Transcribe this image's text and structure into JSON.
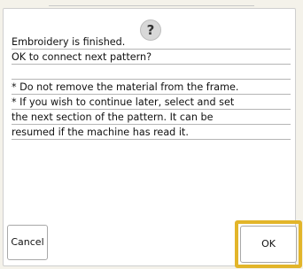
{
  "dialog": {
    "icon": "question-icon",
    "icon_glyph": "?",
    "message_lines": [
      "Embroidery is finished.",
      "OK to connect next pattern?",
      "",
      "* Do not remove the material from the frame.",
      "* If you wish to continue later, select and set",
      "the next section of the pattern. It can be",
      "resumed if the machine has read it."
    ],
    "cancel_label": "Cancel",
    "ok_label": "OK"
  }
}
